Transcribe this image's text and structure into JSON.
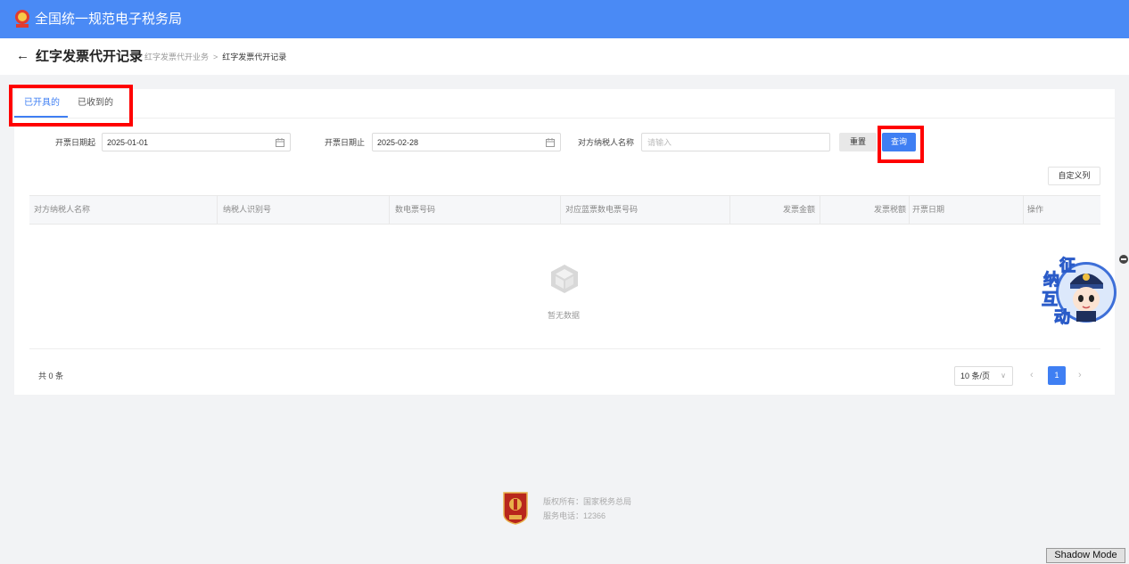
{
  "header": {
    "app_title": "全国统一规范电子税务局"
  },
  "page": {
    "back_icon": "←",
    "title": "红字发票代开记录",
    "breadcrumb": [
      "红字发票代开业务",
      "红字发票代开记录"
    ],
    "breadcrumb_sep": ">"
  },
  "tabs": [
    {
      "label": "已开具的",
      "active": true
    },
    {
      "label": "已收到的",
      "active": false
    }
  ],
  "filters": {
    "start_label": "开票日期起",
    "start_value": "2025-01-01",
    "end_label": "开票日期止",
    "end_value": "2025-02-28",
    "party_label": "对方纳税人名称",
    "party_placeholder": "请输入",
    "reset_label": "重置",
    "query_label": "查询"
  },
  "table": {
    "customize_label": "自定义列",
    "columns": [
      "对方纳税人名称",
      "纳税人识别号",
      "数电票号码",
      "对应蓝票数电票号码",
      "发票金额",
      "发票税额",
      "开票日期",
      "操作"
    ],
    "rows": [],
    "empty_text": "暂无数据"
  },
  "pagination": {
    "total_text": "共 0 条",
    "page_size": "10 条/页",
    "current_page": "1",
    "prev_icon": "‹",
    "next_icon": "›",
    "dropdown_icon": "∨"
  },
  "floating_widget": {
    "chars": [
      "征",
      "纳",
      "互",
      "动"
    ]
  },
  "footer": {
    "logo_text": "税徽",
    "copyright": "版权所有：国家税务总局",
    "phone": "服务电话：12366"
  },
  "shadow_mode": {
    "label": "Shadow Mode"
  },
  "colors": {
    "primary": "#3f7ff3",
    "topbar": "#4a8af5",
    "highlight": "#ff0000"
  }
}
